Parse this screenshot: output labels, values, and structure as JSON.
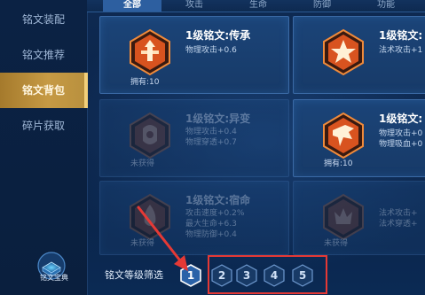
{
  "sidebar": {
    "items": [
      {
        "label": "铭文装配",
        "active": false
      },
      {
        "label": "铭文推荐",
        "active": false
      },
      {
        "label": "铭文背包",
        "active": true
      },
      {
        "label": "碎片获取",
        "active": false
      }
    ],
    "codex_label": "铭文宝典"
  },
  "tabs": [
    {
      "label": "全部",
      "active": true
    },
    {
      "label": "攻击",
      "active": false
    },
    {
      "label": "生命",
      "active": false
    },
    {
      "label": "防御",
      "active": false
    },
    {
      "label": "功能",
      "active": false
    }
  ],
  "cards": [
    {
      "title": "1级铭文:传承",
      "stats": [
        "物理攻击+0.6"
      ],
      "owned": "拥有:10",
      "obtained": true,
      "color": "#e25a24"
    },
    {
      "title": "1级铭文:",
      "stats": [
        "法术攻击+1"
      ],
      "owned": "",
      "obtained": true,
      "color": "#e25a24"
    },
    {
      "title": "1级铭文:异变",
      "stats": [
        "物理攻击+0.4",
        "物理穿透+0.7"
      ],
      "owned": "未获得",
      "obtained": false,
      "color": "#8a4a3a"
    },
    {
      "title": "1级铭文:",
      "stats": [
        "物理攻击+0",
        "物理吸血+0"
      ],
      "owned": "拥有:10",
      "obtained": true,
      "color": "#e25a24"
    },
    {
      "title": "1级铭文:宿命",
      "stats": [
        "攻击速度+0.2%",
        "最大生命+6.3",
        "物理防御+0.4"
      ],
      "owned": "未获得",
      "obtained": false,
      "color": "#8a4a3a"
    },
    {
      "title": "",
      "stats": [
        "法术攻击+",
        "法术穿透+"
      ],
      "owned": "未获得",
      "obtained": false,
      "color": "#8a4a3a"
    }
  ],
  "filter": {
    "label": "铭文等级筛选",
    "levels": [
      "1",
      "2",
      "3",
      "4",
      "5"
    ],
    "selected": "1"
  },
  "colors": {
    "active_sidebar": "#b8903e",
    "active_tab": "#2d5fa0",
    "annotation_red": "#e53935"
  }
}
